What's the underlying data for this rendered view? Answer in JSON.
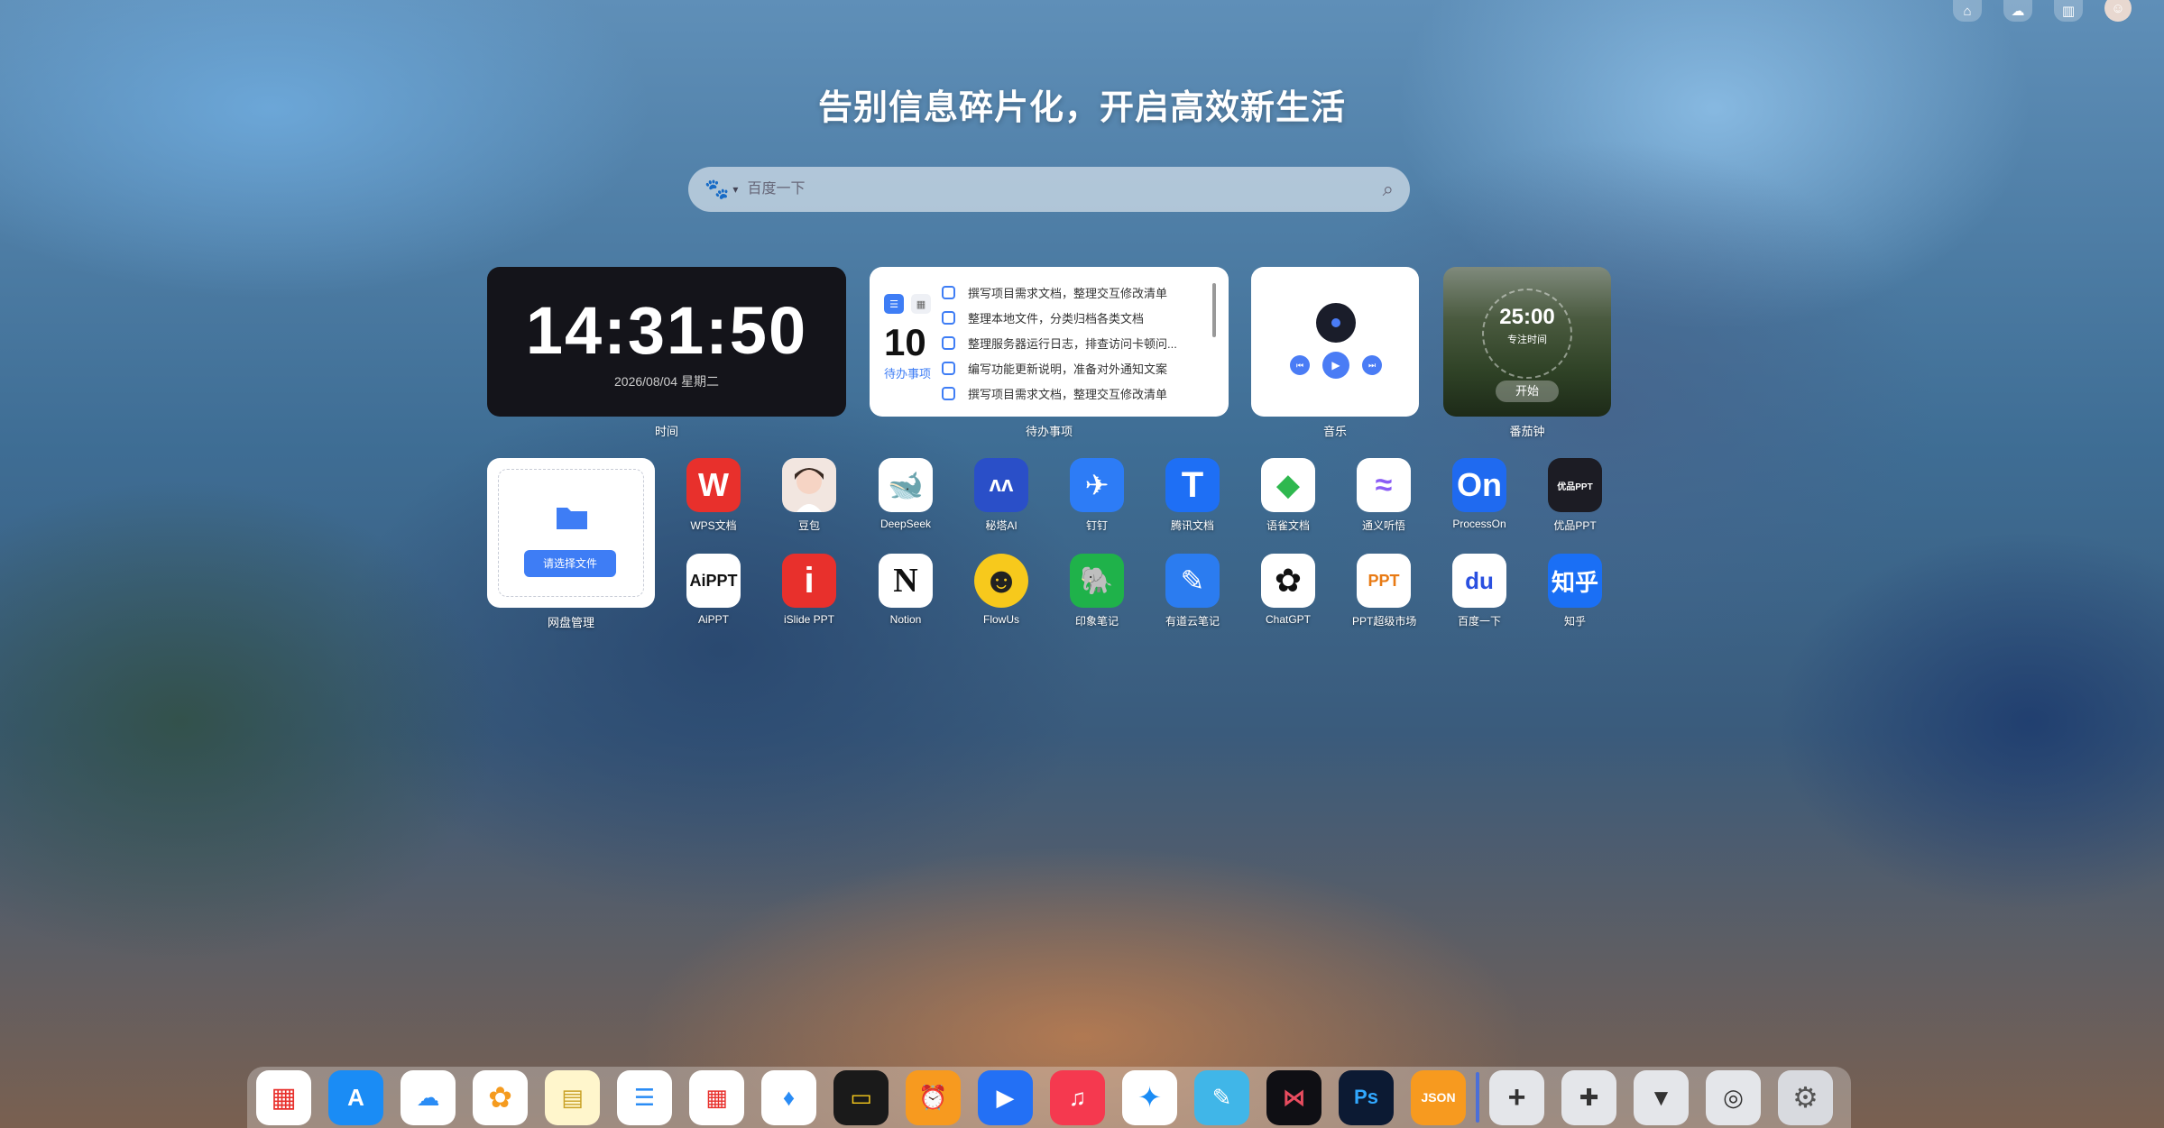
{
  "top_bar": {
    "icons": [
      "home-icon",
      "cloud-icon",
      "sidebar-icon",
      "user-avatar"
    ]
  },
  "headline": "告别信息碎片化，开启高效新生活",
  "search": {
    "placeholder": "百度一下",
    "engine": "baidu-paw-icon"
  },
  "widgets": {
    "clock": {
      "time": "14:31:50",
      "date": "2026/08/04 星期二",
      "caption": "时间"
    },
    "todo": {
      "count": "10",
      "count_label": "待办事项",
      "caption": "待办事项",
      "items": [
        "撰写项目需求文档，整理交互修改清单",
        "整理本地文件，分类归档各类文档",
        "整理服务器运行日志，排查访问卡顿问...",
        "编写功能更新说明，准备对外通知文案",
        "撰写项目需求文档，整理交互修改清单"
      ]
    },
    "music": {
      "caption": "音乐"
    },
    "pomodoro": {
      "time": "25:00",
      "label": "专注时间",
      "button": "开始",
      "caption": "番茄钟"
    },
    "netdisk": {
      "button": "请选择文件",
      "caption": "网盘管理"
    }
  },
  "apps_row1": [
    {
      "label": "WPS文档",
      "icon": "wps-icon",
      "color": "#e8302c"
    },
    {
      "label": "豆包",
      "icon": "doubao-icon",
      "color": "#f2e6e0"
    },
    {
      "label": "DeepSeek",
      "icon": "deepseek-icon",
      "color": "#ffffff"
    },
    {
      "label": "秘塔AI",
      "icon": "metaso-icon",
      "color": "#2a4fc8"
    },
    {
      "label": "钉钉",
      "icon": "dingtalk-icon",
      "color": "#2d7cf6"
    },
    {
      "label": "腾讯文档",
      "icon": "tencent-docs-icon",
      "color": "#1e6ff5"
    },
    {
      "label": "语雀文档",
      "icon": "yuque-icon",
      "color": "#ffffff"
    },
    {
      "label": "通义听悟",
      "icon": "tingwu-icon",
      "color": "#ffffff"
    },
    {
      "label": "ProcessOn",
      "icon": "processon-icon",
      "color": "#1f6af0"
    },
    {
      "label": "优品PPT",
      "icon": "youpin-ppt-icon",
      "color": "#1c1c24"
    }
  ],
  "apps_row2": [
    {
      "label": "AiPPT",
      "icon": "aippt-icon",
      "color": "#ffffff"
    },
    {
      "label": "iSlide PPT",
      "icon": "islide-icon",
      "color": "#e8302c"
    },
    {
      "label": "Notion",
      "icon": "notion-icon",
      "color": "#ffffff"
    },
    {
      "label": "FlowUs",
      "icon": "flowus-icon",
      "color": "#f7c91c"
    },
    {
      "label": "印象笔记",
      "icon": "evernote-icon",
      "color": "#1fb24a"
    },
    {
      "label": "有道云笔记",
      "icon": "youdao-note-icon",
      "color": "#2b7cf0"
    },
    {
      "label": "ChatGPT",
      "icon": "chatgpt-icon",
      "color": "#ffffff"
    },
    {
      "label": "PPT超级市场",
      "icon": "ppt-market-icon",
      "color": "#ffffff"
    },
    {
      "label": "百度一下",
      "icon": "baidu-icon",
      "color": "#ffffff"
    },
    {
      "label": "知乎",
      "icon": "zhihu-icon",
      "color": "#1a6ff5"
    }
  ],
  "app_glyphs": {
    "wps": "W",
    "deepseek": "🐋",
    "metaso": "ʌʌ",
    "dingtalk": "✈",
    "tencent": "T",
    "yuque": "◆",
    "tingwu": "≈",
    "processon": "On",
    "youpin": "优品PPT",
    "aippt": "AiPPT",
    "islide": "i",
    "notion": "N",
    "flowus": "☻",
    "evernote": "🐘",
    "youdao": "✎",
    "chatgpt": "✿",
    "pptmarket": "PPT",
    "baidu": "du",
    "zhihu": "知乎"
  },
  "dock": [
    {
      "icon": "launchpad-icon",
      "color": "#ffffff"
    },
    {
      "icon": "app-store-icon",
      "color": "#1a8cf5"
    },
    {
      "icon": "icloud-icon",
      "color": "#ffffff"
    },
    {
      "icon": "photos-icon",
      "color": "#ffffff"
    },
    {
      "icon": "notes-icon",
      "color": "#fff6cc"
    },
    {
      "icon": "reminders-icon",
      "color": "#ffffff"
    },
    {
      "icon": "calendar-icon",
      "color": "#ffffff"
    },
    {
      "icon": "keynote-icon",
      "color": "#ffffff"
    },
    {
      "icon": "wallet-icon",
      "color": "#1a1a1a"
    },
    {
      "icon": "alarm-icon",
      "color": "#f79a1f"
    },
    {
      "icon": "video-play-icon",
      "color": "#2370f5"
    },
    {
      "icon": "music-icon",
      "color": "#f5394f"
    },
    {
      "icon": "safari-icon",
      "color": "#ffffff"
    },
    {
      "icon": "freeform-icon",
      "color": "#40b6e8"
    },
    {
      "icon": "capcut-icon",
      "color": "#0f0f14"
    },
    {
      "icon": "photoshop-icon",
      "color": "#0c1a33"
    },
    {
      "icon": "json-icon",
      "color": "#f79a1f"
    },
    {
      "icon": "add-icon",
      "color": "#e4e6ea"
    },
    {
      "icon": "plugin-icon",
      "color": "#e4e6ea"
    },
    {
      "icon": "brush-icon",
      "color": "#e4e6ea"
    },
    {
      "icon": "camera-settings-icon",
      "color": "#e4e6ea"
    },
    {
      "icon": "system-settings-icon",
      "color": "#d8dadf"
    }
  ],
  "dock_labels": {
    "photoshop": "Ps",
    "json": "JSON"
  }
}
